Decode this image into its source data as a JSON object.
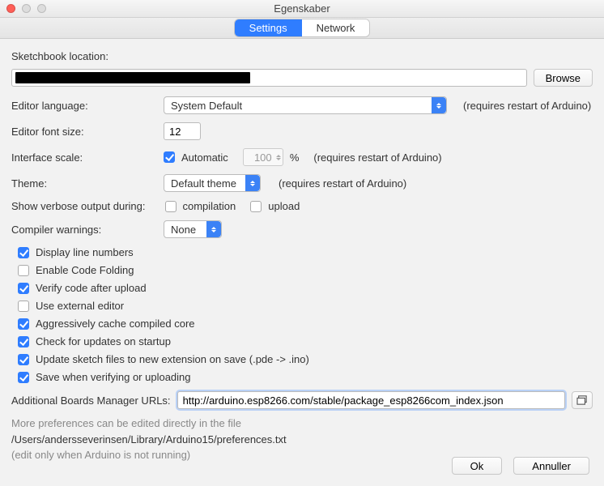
{
  "window": {
    "title": "Egenskaber"
  },
  "tabs": {
    "settings": "Settings",
    "network": "Network"
  },
  "sketchbook": {
    "label": "Sketchbook location:",
    "browse": "Browse"
  },
  "editor_language": {
    "label": "Editor language:",
    "value": "System Default",
    "restart": "(requires restart of Arduino)"
  },
  "font_size": {
    "label": "Editor font size:",
    "value": "12"
  },
  "interface_scale": {
    "label": "Interface scale:",
    "automatic": "Automatic",
    "value": "100",
    "percent": "%",
    "restart": "(requires restart of Arduino)"
  },
  "theme": {
    "label": "Theme:",
    "value": "Default theme",
    "restart": "(requires restart of Arduino)"
  },
  "verbose": {
    "label": "Show verbose output during:",
    "compilation": "compilation",
    "upload": "upload"
  },
  "compiler_warnings": {
    "label": "Compiler warnings:",
    "value": "None"
  },
  "options": [
    {
      "label": "Display line numbers",
      "checked": true
    },
    {
      "label": "Enable Code Folding",
      "checked": false
    },
    {
      "label": "Verify code after upload",
      "checked": true
    },
    {
      "label": "Use external editor",
      "checked": false
    },
    {
      "label": "Aggressively cache compiled core",
      "checked": true
    },
    {
      "label": "Check for updates on startup",
      "checked": true
    },
    {
      "label": "Update sketch files to new extension on save (.pde -> .ino)",
      "checked": true
    },
    {
      "label": "Save when verifying or uploading",
      "checked": true
    }
  ],
  "boards_url": {
    "label": "Additional Boards Manager URLs:",
    "value": "http://arduino.esp8266.com/stable/package_esp8266com_index.json"
  },
  "footer": {
    "line1": "More preferences can be edited directly in the file",
    "line2": "/Users/andersseverinsen/Library/Arduino15/preferences.txt",
    "line3": "(edit only when Arduino is not running)"
  },
  "buttons": {
    "ok": "Ok",
    "cancel": "Annuller"
  }
}
